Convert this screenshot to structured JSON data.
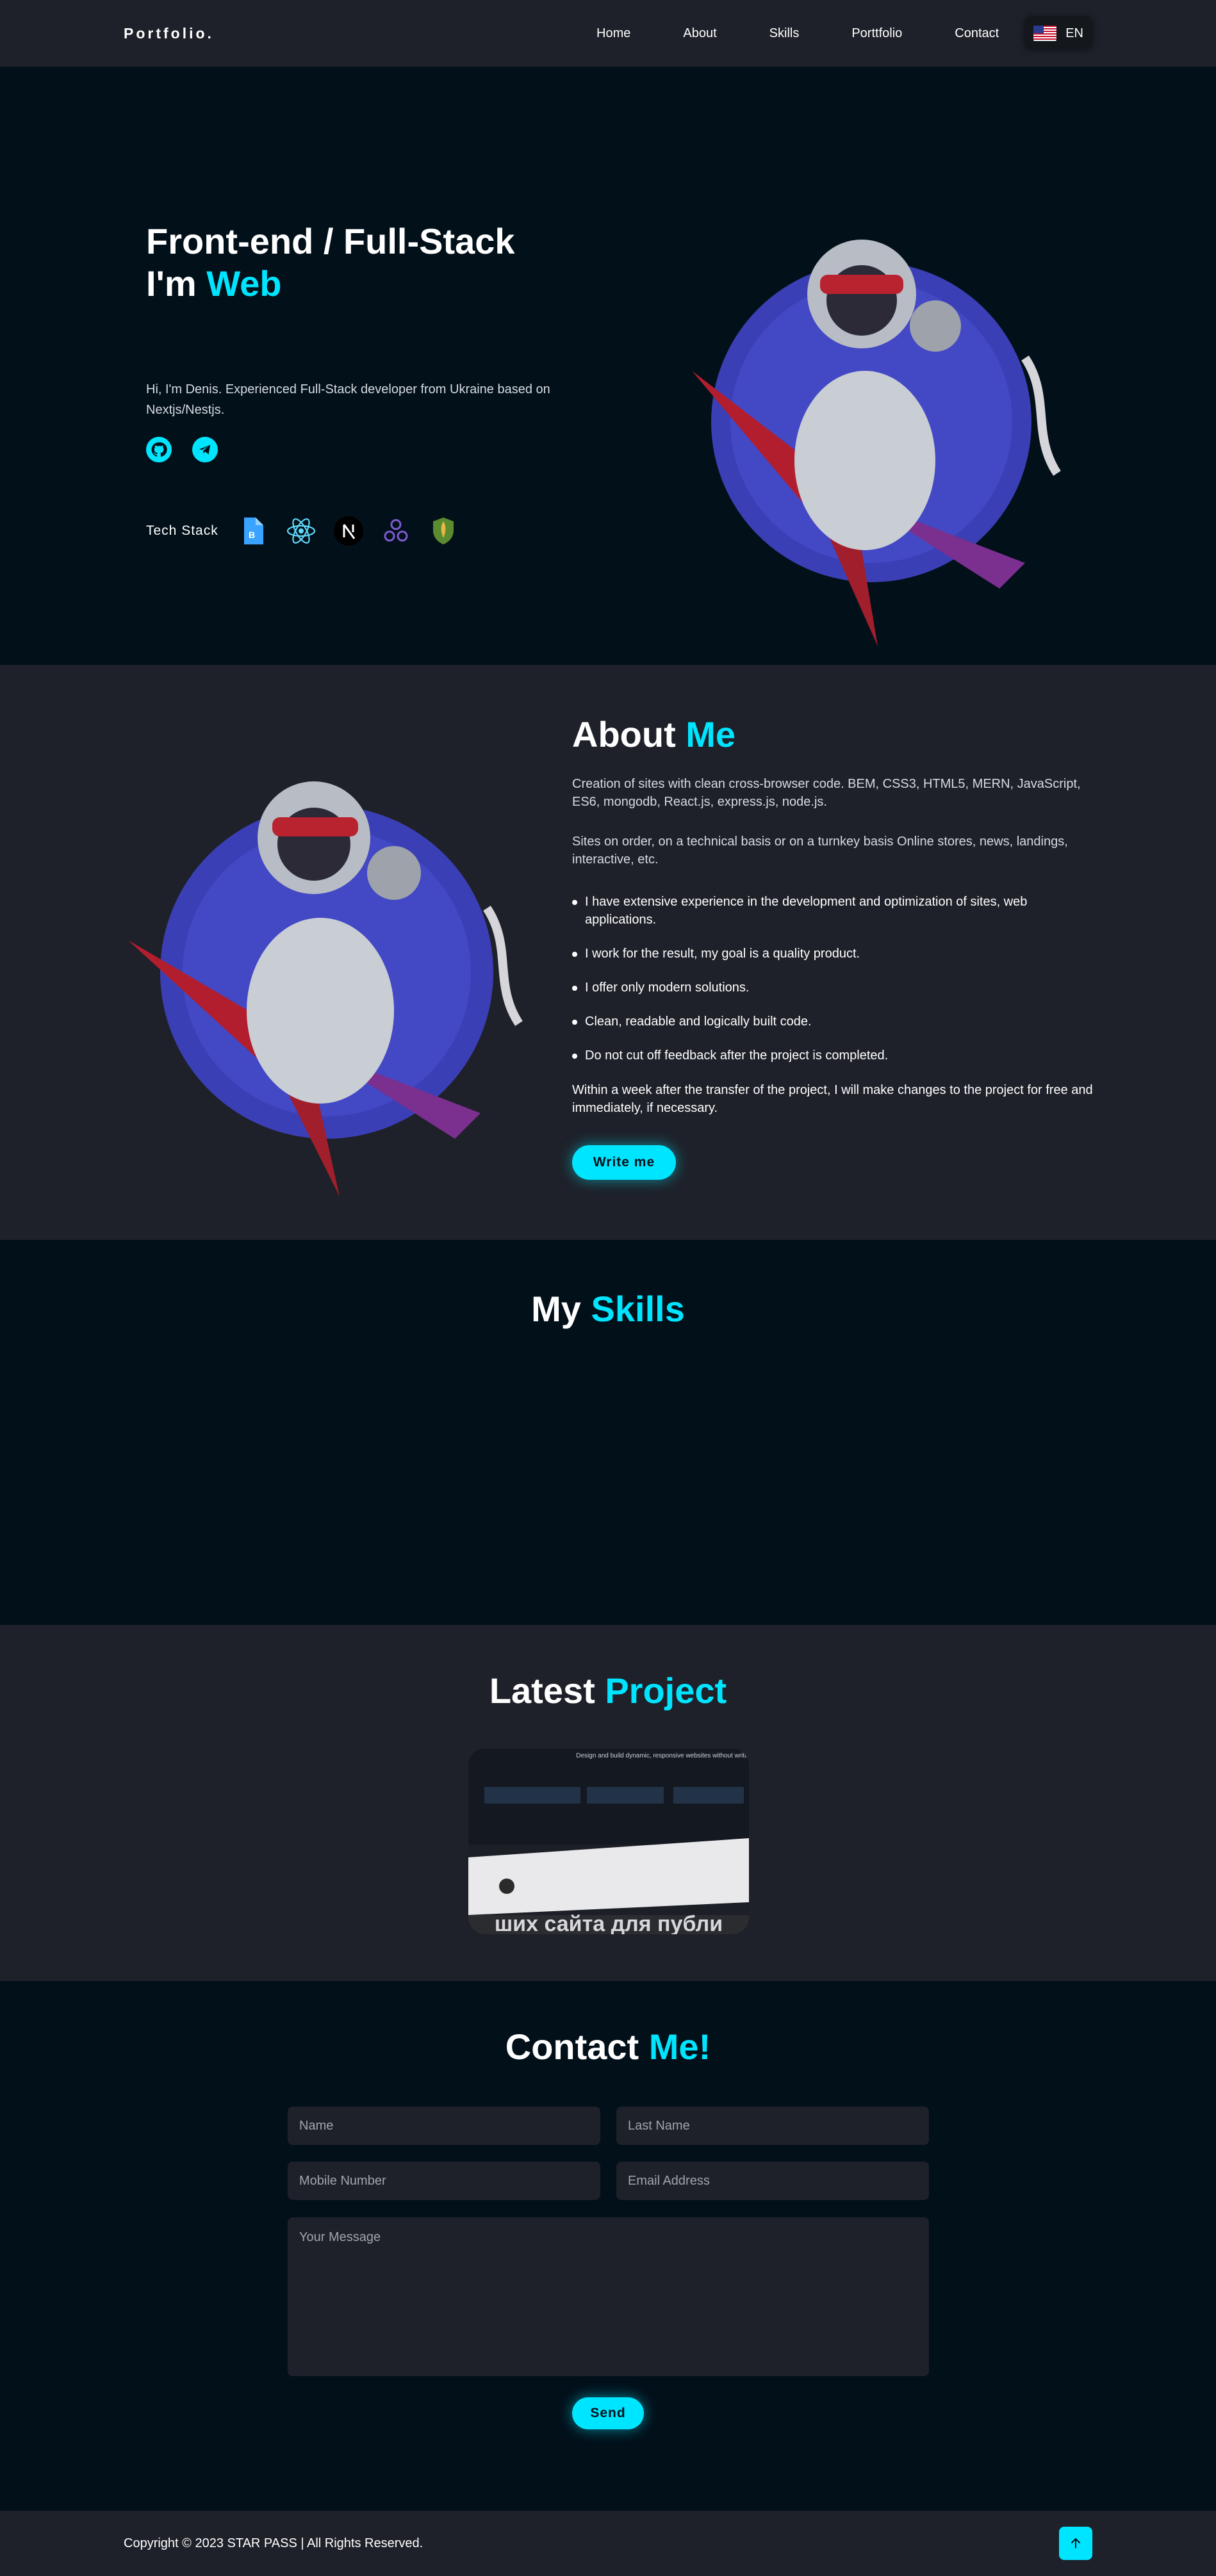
{
  "nav": {
    "logo": "Portfolio.",
    "links": [
      "Home",
      "About",
      "Skills",
      "Porttfolio",
      "Contact"
    ],
    "language": "EN"
  },
  "hero": {
    "title_line1": "Front-end / Full-Stack",
    "title_prefix": "I'm",
    "title_highlight": "Web",
    "description": "Hi, I'm Denis. Experienced Full-Stack developer from Ukraine based on Nextjs/Nestjs.",
    "tech_stack_label": "Tech Stack",
    "tech_icons": [
      "typescript-icon",
      "react-icon",
      "nextjs-icon",
      "redux-icon",
      "mongodb-icon"
    ]
  },
  "about": {
    "title_prefix": "About",
    "title_highlight": "Me",
    "paragraph1": "Creation of sites with clean cross-browser code. BEM, CSS3, HTML5, MERN, JavaScript, ES6, mongodb, React.js, express.js, node.js.",
    "paragraph2": "Sites on order, on a technical basis or on a turnkey basis Online stores, news, landings, interactive, etc.",
    "list": [
      "I have extensive experience in the development and optimization of sites, web applications.",
      "I work for the result, my goal is a quality product.",
      "I offer only modern solutions.",
      "Clean, readable and logically built code.",
      "Do not cut off feedback after the project is completed."
    ],
    "paragraph3": "Within a week after the transfer of the project, I will make changes to the project for free and immediately, if necessary.",
    "button": "Write me"
  },
  "skills": {
    "title_prefix": "My",
    "title_highlight": "Skills"
  },
  "projects": {
    "title_prefix": "Latest",
    "title_highlight": "Project",
    "card_text_top": "Design and build dynamic, responsive websites without writing code.",
    "card_text_bottom": "ших сайта для публи"
  },
  "contact": {
    "title_prefix": "Contact",
    "title_highlight": "Me!",
    "placeholders": {
      "name": "Name",
      "last_name": "Last Name",
      "mobile": "Mobile Number",
      "email": "Email Address",
      "message": "Your Message"
    },
    "button": "Send"
  },
  "footer": {
    "copyright": "Copyright © 2023 STAR PASS | All Rights Reserved."
  },
  "colors": {
    "accent": "#00e5ff",
    "dark_bg": "#02101a",
    "panel_bg": "#1e2129"
  }
}
